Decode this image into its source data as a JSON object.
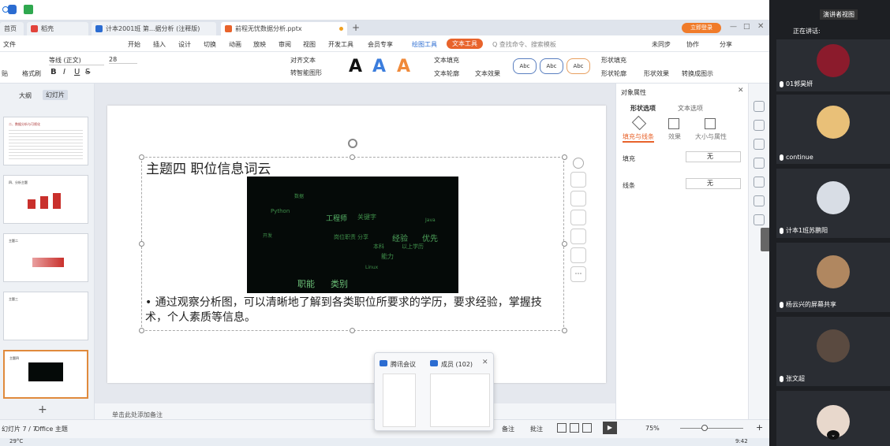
{
  "topbar": {
    "green_badge_text": "",
    "shield_badge_text": ""
  },
  "tabs": [
    {
      "label": "首页"
    },
    {
      "label": "稻壳"
    },
    {
      "label": "计本2001班 第...据分析 (注释版)"
    },
    {
      "label": "前程无忧数据分析.pptx"
    }
  ],
  "window_actions": {
    "login_label": "立即登录",
    "add_tab": "+"
  },
  "menu": {
    "file": "文件",
    "items": [
      "开始",
      "插入",
      "设计",
      "切换",
      "动画",
      "放映",
      "审阅",
      "视图",
      "开发工具",
      "会员专享"
    ],
    "drawing_tools": "绘图工具",
    "text_tools": "文本工具",
    "search_placeholder": "Q 查找命令、搜索模板",
    "sync": "未同步",
    "collab": "协作",
    "share": "分享"
  },
  "ribbon": {
    "font_name": "等线 (正文)",
    "font_size": "28",
    "paste_label": "贴",
    "format_painter": "格式刷",
    "bold": "B",
    "italic": "I",
    "underline": "U",
    "strike": "S",
    "align_text": "对齐文本",
    "smart_shape": "转智能图形",
    "text_fill": "文本填充",
    "text_outline": "文本轮廓",
    "text_effect": "文本效果",
    "shape_fill": "形状填充",
    "shape_outline": "形状轮廓",
    "shape_effect": "形状效果",
    "convert_graphic": "转换成图示",
    "style_boxes": [
      "Abc",
      "Abc",
      "Abc"
    ],
    "big_a": "A"
  },
  "left_panel": {
    "tab_outline": "大纲",
    "tab_slides": "幻灯片",
    "thumbs": [
      {
        "title": "二、数据分析与可视化"
      },
      {
        "title": "四、分析主题"
      },
      {
        "title": "主题二"
      },
      {
        "title": "主题三"
      },
      {
        "title": "主题四"
      }
    ],
    "add_slide": "+"
  },
  "slide": {
    "title": "主题四 职位信息词云",
    "bullet": "• 通过观察分析图，可以清晰地了解到各类职位所要求的学历，要求经验，掌握技术，个人素质等信息。",
    "wordcloud_words": [
      "工程师",
      "关键字",
      "Python",
      "经验",
      "优先",
      "分享",
      "岗位职责",
      "能力",
      "职能",
      "类别",
      "本科",
      "以上学历",
      "开发",
      "数据",
      "Java",
      "Linux"
    ]
  },
  "right_panel": {
    "title": "对象属性",
    "tab_shape": "形状选项",
    "tab_text": "文本选项",
    "sub_fill": "填充与线条",
    "sub_effect": "效果",
    "sub_size": "大小与属性",
    "fill_label": "填充",
    "fill_value": "无",
    "line_label": "线条",
    "line_value": "无"
  },
  "status": {
    "slide_info": "幻灯片 7 / 7",
    "theme": "Office 主题",
    "notes_placeholder": "单击此处添加备注",
    "notes_btn": "备注",
    "comment_btn": "批注",
    "zoom": "75%"
  },
  "taskbar": {
    "temperature": "29°C",
    "time": "9:42"
  },
  "popup": {
    "app_name": "腾讯会议",
    "members_label": "成员 (102)"
  },
  "meeting": {
    "presenter_view": "演讲者视图",
    "speaking_label": "正在讲话:",
    "participants": [
      {
        "name": "01郭昊妍"
      },
      {
        "name": "continue"
      },
      {
        "name": "计本1班苏鹏阳"
      },
      {
        "name": "杨云兴的屏幕共享"
      },
      {
        "name": "张文超"
      },
      {
        "name": ""
      }
    ]
  },
  "colors": {
    "accent_orange": "#e8632b",
    "wps_blue": "#2b6cd1",
    "meeting_bg": "#1d1f23",
    "wordcloud_green": "#3f8f4a"
  }
}
